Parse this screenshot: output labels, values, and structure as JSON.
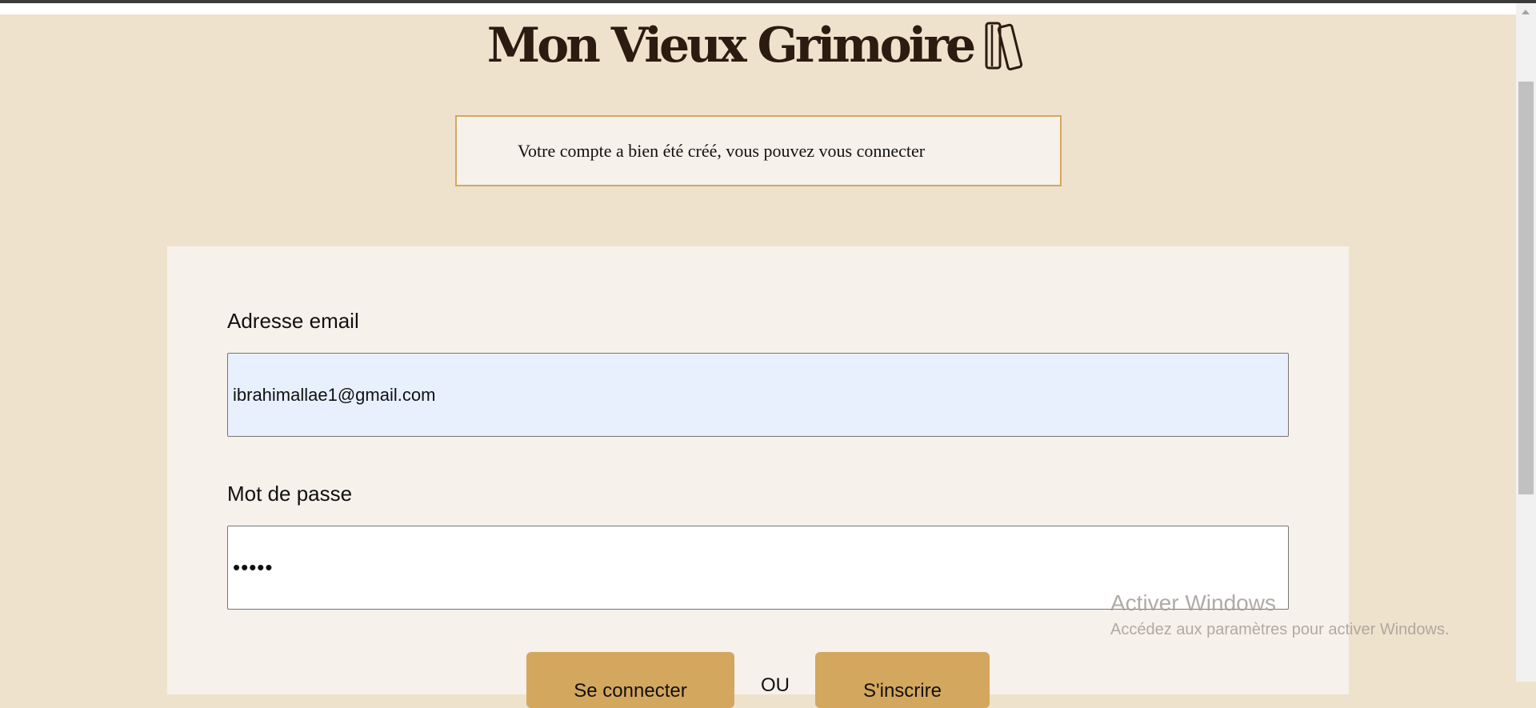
{
  "header": {
    "logo_text": "Mon Vieux Grimoire",
    "logo_icon": "books-icon"
  },
  "alert": {
    "message": "Votre compte a bien été créé, vous pouvez vous connecter"
  },
  "form": {
    "email_label": "Adresse email",
    "email_value": "ibrahimallae1@gmail.com",
    "password_label": "Mot de passe",
    "password_value": "•••••",
    "signin_label": "Se connecter",
    "or_text": "OU",
    "signup_label": "S'inscrire"
  },
  "watermark": {
    "title": "Activer Windows",
    "subtitle": "Accédez aux paramètres pour activer Windows."
  },
  "colors": {
    "background": "#efe2cc",
    "card": "#f7f1eb",
    "accent": "#d4a75f",
    "logo": "#2b1b10",
    "autofill": "#e8f0fe"
  }
}
